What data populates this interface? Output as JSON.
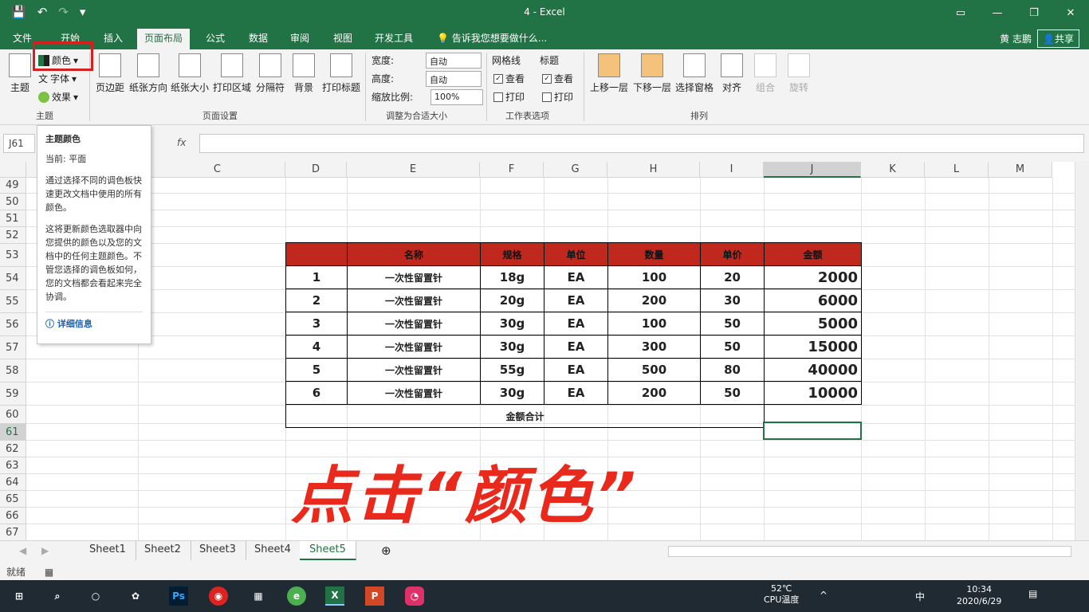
{
  "window": {
    "title": "4 - Excel",
    "user": "黄 志鹏",
    "share": "共享"
  },
  "tabs": [
    "文件",
    "开始",
    "插入",
    "页面布局",
    "公式",
    "数据",
    "审阅",
    "视图",
    "开发工具"
  ],
  "tell_me": "告诉我您想要做什么...",
  "ribbon": {
    "theme_group": "主题",
    "theme_btn": "主题",
    "colors": "颜色",
    "fonts": "字体",
    "effects": "效果",
    "page_setup_group": "页面设置",
    "margins": "页边距",
    "orientation": "纸张方向",
    "size": "纸张大小",
    "print_area": "打印区域",
    "breaks": "分隔符",
    "background": "背景",
    "print_titles": "打印标题",
    "scale_group": "调整为合适大小",
    "width_label": "宽度:",
    "height_label": "高度:",
    "scale_label": "缩放比例:",
    "width_val": "自动",
    "height_val": "自动",
    "scale_val": "100%",
    "sheet_opts_group": "工作表选项",
    "gridlines": "网格线",
    "headings": "标题",
    "view": "查看",
    "print": "打印",
    "arrange_group": "排列",
    "bring_forward": "上移一层",
    "send_backward": "下移一层",
    "selection_pane": "选择窗格",
    "align": "对齐",
    "group": "组合",
    "rotate": "旋转"
  },
  "namebox": "J61",
  "fx": "fx",
  "columns": [
    "C",
    "D",
    "E",
    "F",
    "G",
    "H",
    "I",
    "J",
    "K",
    "L",
    "M"
  ],
  "rows": [
    "49",
    "50",
    "51",
    "52",
    "53",
    "54",
    "55",
    "56",
    "57",
    "58",
    "59",
    "60",
    "61",
    "62",
    "63",
    "64",
    "65",
    "66",
    "67"
  ],
  "table": {
    "headers": [
      "名称",
      "规格",
      "单位",
      "数量",
      "单价",
      "金额"
    ],
    "rows": [
      [
        "1",
        "一次性留置针",
        "18g",
        "EA",
        "100",
        "20",
        "2000"
      ],
      [
        "2",
        "一次性留置针",
        "20g",
        "EA",
        "200",
        "30",
        "6000"
      ],
      [
        "3",
        "一次性留置针",
        "30g",
        "EA",
        "100",
        "50",
        "5000"
      ],
      [
        "4",
        "一次性留置针",
        "30g",
        "EA",
        "300",
        "50",
        "15000"
      ],
      [
        "5",
        "一次性留置针",
        "55g",
        "EA",
        "500",
        "80",
        "40000"
      ],
      [
        "6",
        "一次性留置针",
        "30g",
        "EA",
        "200",
        "50",
        "10000"
      ]
    ],
    "total_label": "金额合计"
  },
  "tooltip": {
    "title": "主题颜色",
    "current": "当前: 平面",
    "p1": "通过选择不同的调色板快速更改文档中使用的所有颜色。",
    "p2": "这将更新颜色选取器中向您提供的颜色以及您的文档中的任何主题颜色。不管您选择的调色板如何，您的文档都会看起来完全协调。",
    "link": "详细信息"
  },
  "overlay": "点击“颜色”",
  "sheets": [
    "Sheet1",
    "Sheet2",
    "Sheet3",
    "Sheet4",
    "Sheet5"
  ],
  "status": "就绪",
  "taskbar": {
    "temp": "52℃",
    "temp_label": "CPU温度",
    "time": "10:34",
    "date": "2020/6/29",
    "ime": "中"
  }
}
